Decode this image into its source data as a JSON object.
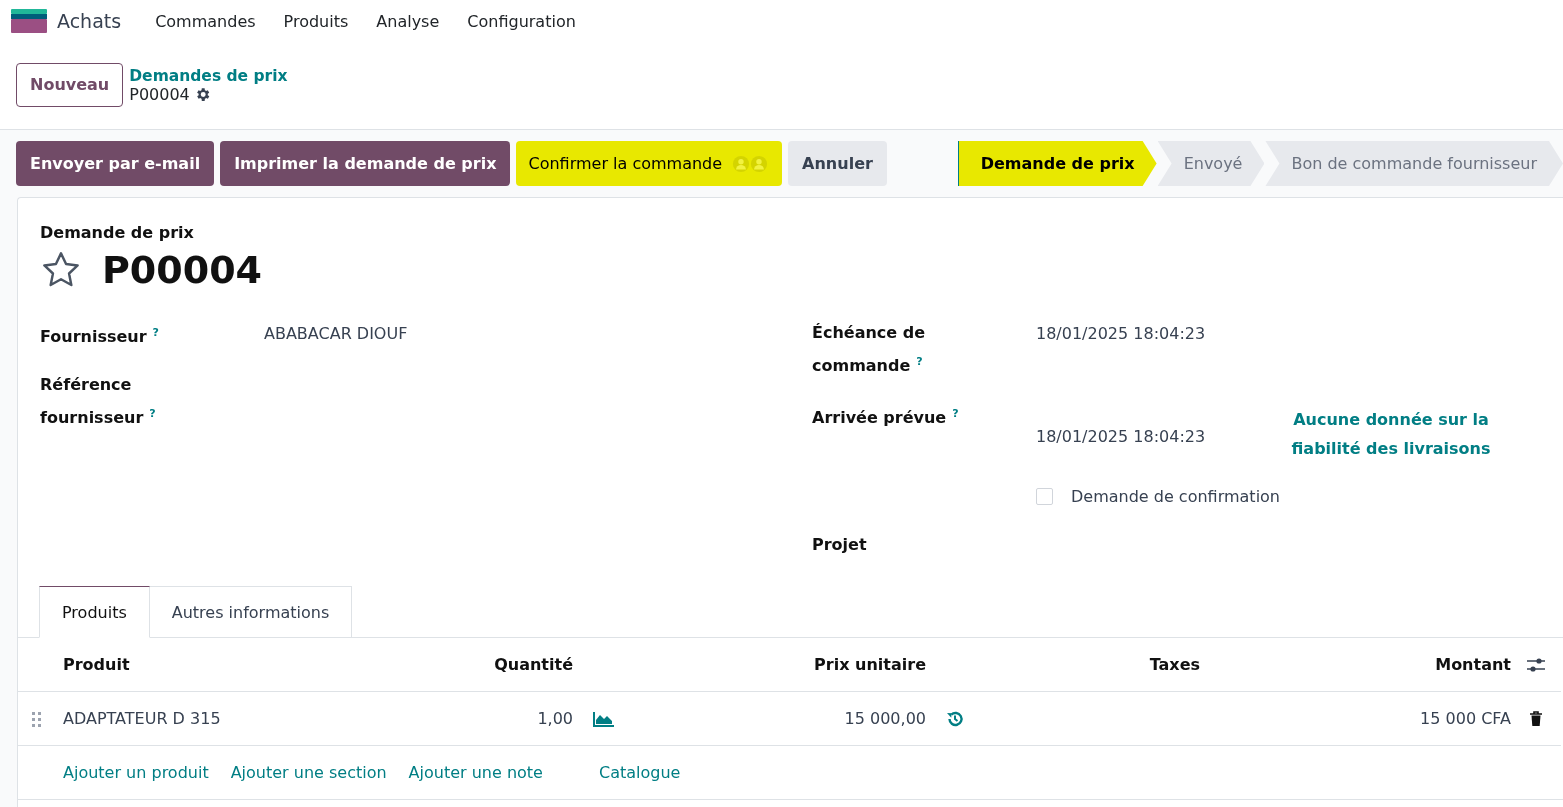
{
  "app": {
    "name": "Achats"
  },
  "menu": [
    "Commandes",
    "Produits",
    "Analyse",
    "Configuration"
  ],
  "new_button": "Nouveau",
  "breadcrumb": {
    "parent": "Demandes de prix",
    "current": "P00004"
  },
  "actions": [
    {
      "label": "Envoyer par e-mail",
      "kind": "primary",
      "highlighted": false
    },
    {
      "label": "Imprimer la demande de prix",
      "kind": "primary",
      "highlighted": false
    },
    {
      "label": "Confirmer la commande",
      "kind": "confirm",
      "highlighted": true
    },
    {
      "label": "Annuler",
      "kind": "secondary",
      "highlighted": false
    }
  ],
  "status_steps": [
    {
      "label": "Demande de prix",
      "selected": true,
      "highlighted": true
    },
    {
      "label": "Envoyé",
      "selected": false,
      "highlighted": false
    },
    {
      "label": "Bon de commande fournisseur",
      "selected": false,
      "highlighted": false
    }
  ],
  "form": {
    "subtitle": "Demande de prix",
    "title": "P00004",
    "starred": false,
    "left_fields": [
      {
        "kind": "field",
        "label": "Fournisseur",
        "help": "?",
        "value": "ABABACAR DIOUF"
      },
      {
        "kind": "field",
        "label": "Référence fournisseur",
        "help": "?"
      }
    ],
    "right_fields": [
      {
        "kind": "field",
        "label": "Échéance de commande",
        "help": "?",
        "value": "18/01/2025 18:04:23"
      },
      {
        "kind": "field",
        "label": "Arrivée prévue",
        "help": "?",
        "value": "18/01/2025 18:04:23",
        "note": "Aucune donnée sur la fiabilité des livraisons"
      },
      {
        "kind": "checkbox",
        "label": "Demande de confirmation",
        "checked": false
      },
      {
        "kind": "field",
        "label": "Projet"
      }
    ]
  },
  "tabs": [
    {
      "label": "Produits",
      "selected": true
    },
    {
      "label": "Autres informations",
      "selected": false
    }
  ],
  "table": {
    "columns": [
      "Produit",
      "Quantité",
      "Prix unitaire",
      "Taxes",
      "Montant"
    ],
    "rows": [
      {
        "product": "ADAPTATEUR D 315",
        "quantity": "1,00",
        "unit_price": "15 000,00",
        "amount": "15 000 CFA"
      }
    ]
  },
  "add_links": [
    "Ajouter un produit",
    "Ajouter une section",
    "Ajouter une note",
    "Catalogue"
  ]
}
